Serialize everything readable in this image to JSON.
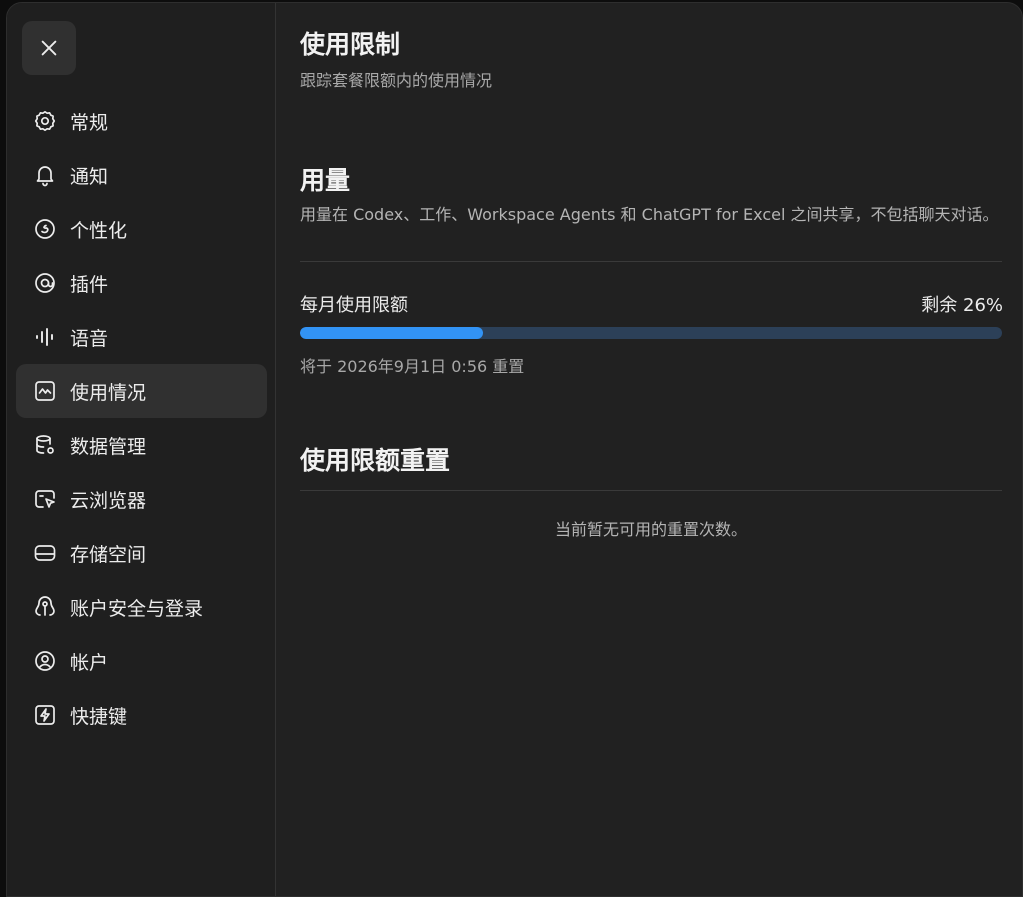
{
  "sidebar": {
    "close_icon": "close-icon",
    "items": [
      {
        "label": "常规",
        "icon": "gear-icon"
      },
      {
        "label": "通知",
        "icon": "bell-icon"
      },
      {
        "label": "个性化",
        "icon": "personalize-icon"
      },
      {
        "label": "插件",
        "icon": "plugin-icon"
      },
      {
        "label": "语音",
        "icon": "voice-wave-icon"
      },
      {
        "label": "使用情况",
        "icon": "usage-chart-icon",
        "active": true
      },
      {
        "label": "数据管理",
        "icon": "database-gear-icon"
      },
      {
        "label": "云浏览器",
        "icon": "cloud-browser-icon"
      },
      {
        "label": "存储空间",
        "icon": "storage-drive-icon"
      },
      {
        "label": "账户安全与登录",
        "icon": "security-keyhole-icon"
      },
      {
        "label": "帐户",
        "icon": "account-circle-icon"
      },
      {
        "label": "快捷键",
        "icon": "shortcut-bolt-icon"
      }
    ]
  },
  "main": {
    "title": "使用限制",
    "subtitle": "跟踪套餐限额内的使用情况",
    "usage": {
      "title": "用量",
      "description": "用量在 Codex、工作、Workspace Agents 和 ChatGPT for Excel 之间共享，不包括聊天对话。",
      "monthly_label": "每月使用限额",
      "remaining_label": "剩余 26%",
      "used_fraction": 0.26,
      "reset_text": "将于 2026年9月1日 0:56 重置"
    },
    "reset": {
      "title": "使用限额重置",
      "empty_text": "当前暂无可用的重置次数。"
    }
  },
  "colors": {
    "background": "#212121",
    "active_item": "#303030",
    "progress_fill": "#3293f5",
    "progress_track": "#2c4058"
  }
}
